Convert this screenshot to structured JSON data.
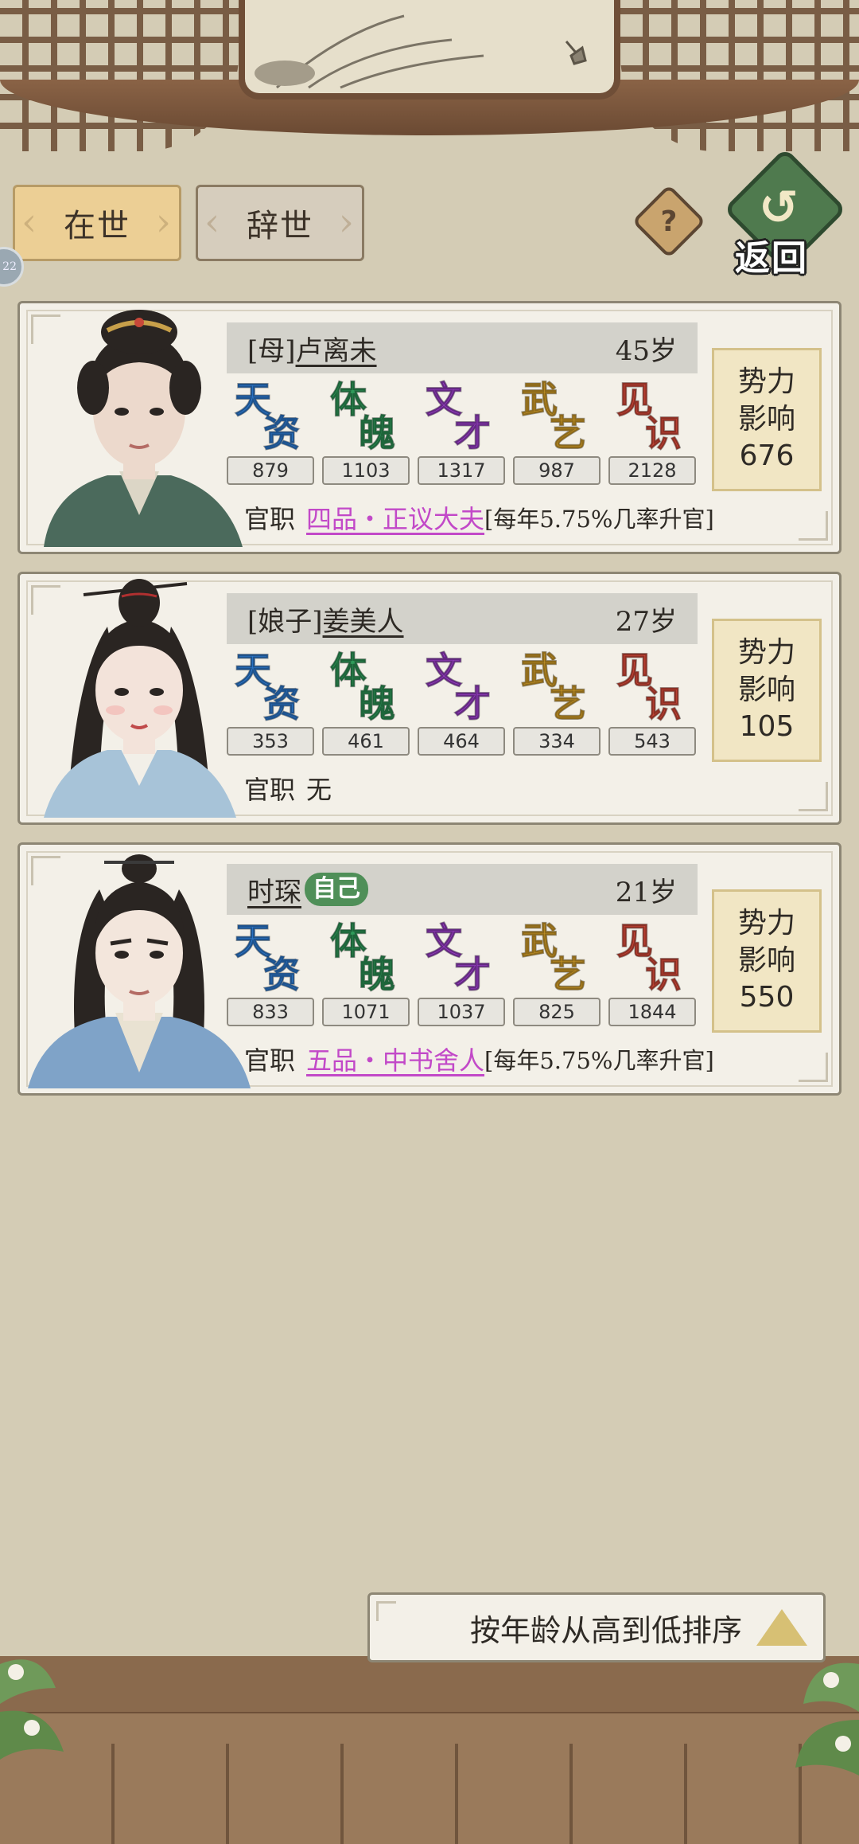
{
  "tabs": {
    "alive": "在世",
    "deceased": "辞世"
  },
  "status_badge": "22",
  "help_symbol": "?",
  "return_label": "返回",
  "stat_names": [
    "天资",
    "体魄",
    "文才",
    "武艺",
    "见识"
  ],
  "stat_colors": [
    "#2f7fd8",
    "#2f9a5a",
    "#9a3fc8",
    "#d8a22a",
    "#d84a3a"
  ],
  "office_label": "官职",
  "influence_label_1": "势力",
  "influence_label_2": "影响",
  "members": [
    {
      "relation": "[母]",
      "name": "卢离未",
      "age": "45岁",
      "stats": [
        "879",
        "1103",
        "1317",
        "987",
        "2128"
      ],
      "office_rank": "四品・正议大夫",
      "office_chance": "[每年5.75%几率升官]",
      "influence": "676"
    },
    {
      "relation": "[娘子]",
      "name": "姜美人",
      "age": "27岁",
      "stats": [
        "353",
        "461",
        "464",
        "334",
        "543"
      ],
      "office_rank": "无",
      "office_chance": "",
      "influence": "105"
    },
    {
      "relation": "",
      "name": "时琛",
      "self_badge": "自己",
      "age": "21岁",
      "stats": [
        "833",
        "1071",
        "1037",
        "825",
        "1844"
      ],
      "office_rank": "五品・中书舍人",
      "office_chance": "[每年5.75%几率升官]",
      "influence": "550"
    }
  ],
  "sort_button": "按年龄从高到低排序",
  "colors": {
    "background": "#d4ccb5",
    "tab_active": "#eccf95",
    "rank_purple": "#c249c8",
    "return_green": "#4f7a4e"
  }
}
